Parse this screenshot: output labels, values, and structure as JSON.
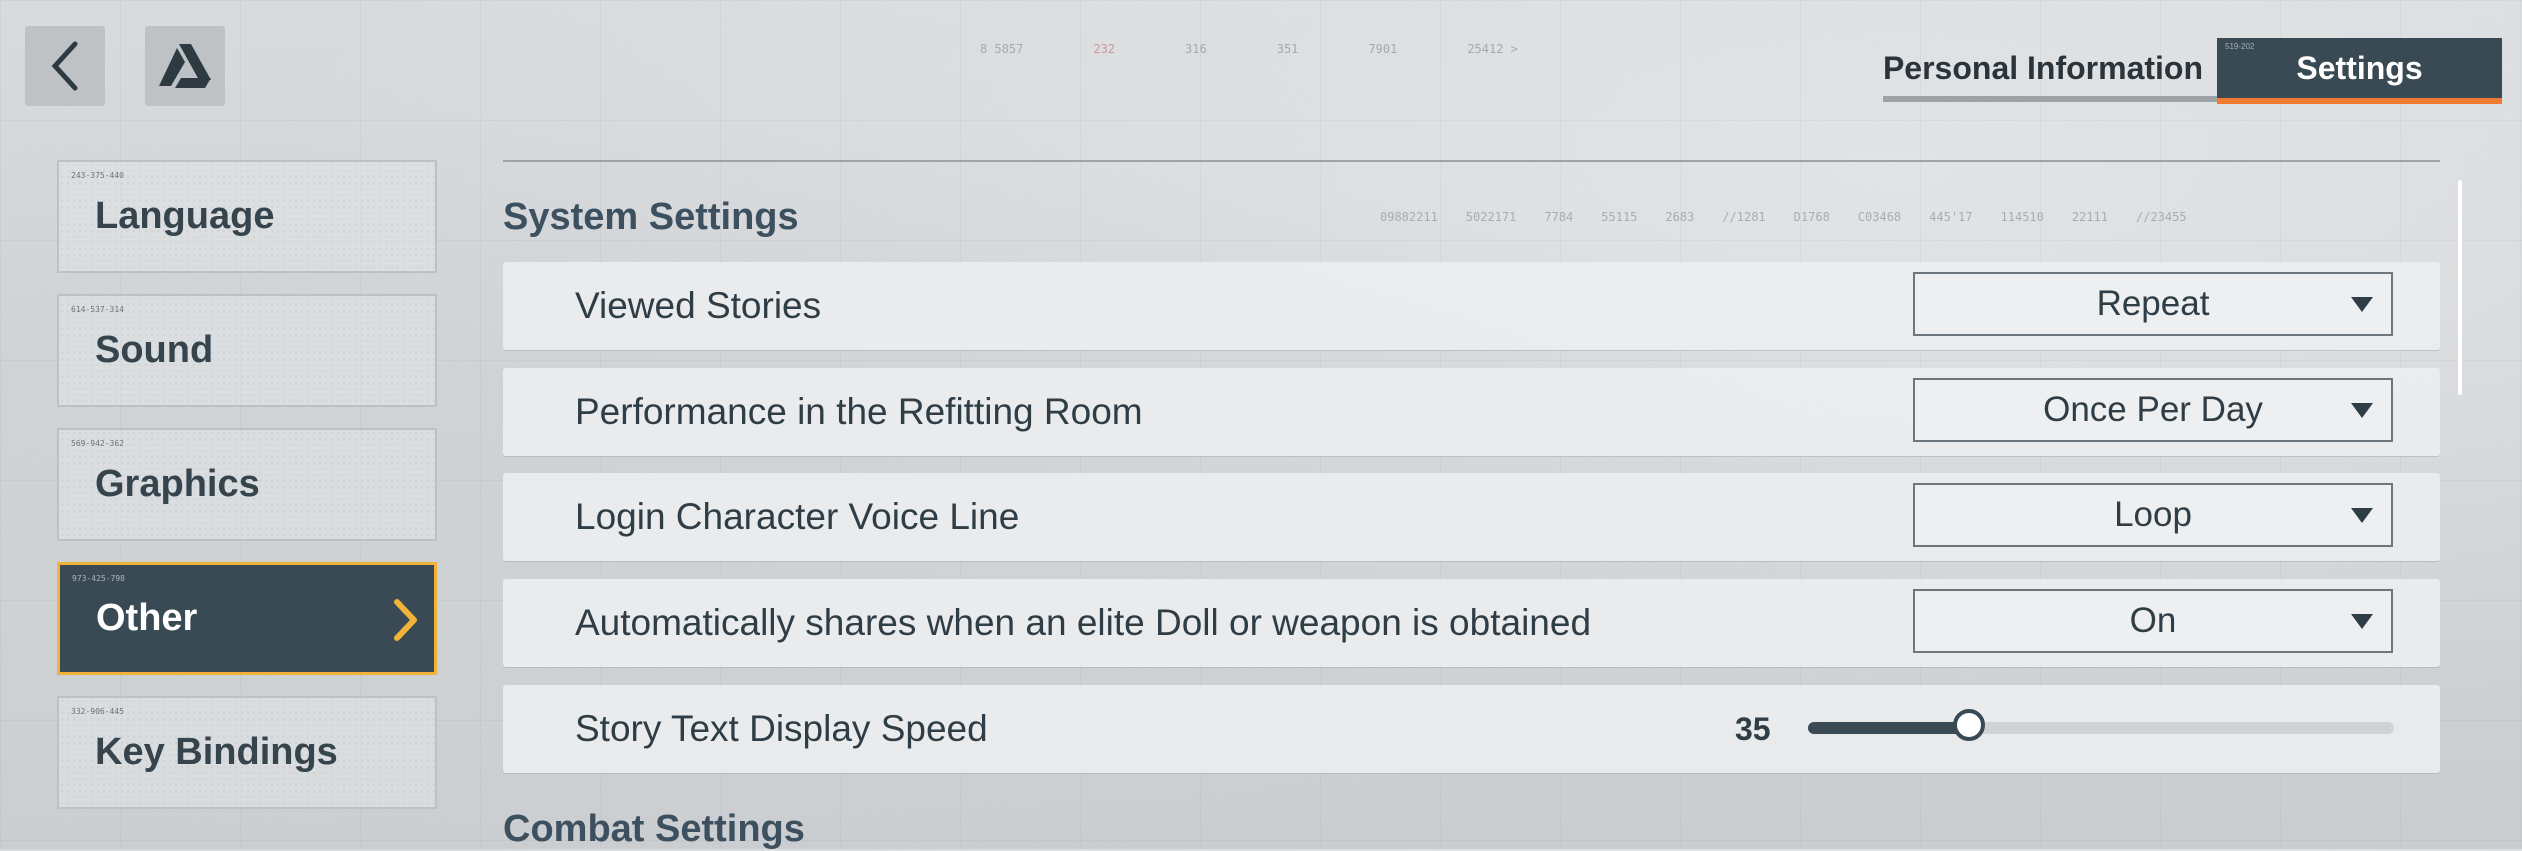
{
  "top_codes": [
    "8  5857",
    "232",
    "316",
    "351",
    "7901",
    "25412  >"
  ],
  "mid_codes": [
    "09882211",
    "5022171",
    "7784",
    "55115",
    "2683",
    "//1281",
    "D1768",
    "C03468",
    "445'17",
    "114510",
    "22111",
    "//23455"
  ],
  "nav": {
    "back_icon": "chevron-left-icon",
    "logo_icon": "triangle-logo-icon"
  },
  "tabs": [
    {
      "label": "Personal Information",
      "active": false
    },
    {
      "label": "Settings",
      "active": true,
      "code": "519-202"
    }
  ],
  "sidebar": {
    "items": [
      {
        "label": "Language",
        "code": "243-375-440"
      },
      {
        "label": "Sound",
        "code": "614-537-314"
      },
      {
        "label": "Graphics",
        "code": "569-942-362"
      },
      {
        "label": "Other",
        "code": "973-425-798",
        "active": true
      },
      {
        "label": "Key Bindings",
        "code": "332-906-445"
      }
    ]
  },
  "sections": {
    "system": "System Settings",
    "combat": "Combat Settings"
  },
  "settings": {
    "viewed_stories": {
      "label": "Viewed Stories",
      "value": "Repeat"
    },
    "refitting_room": {
      "label": "Performance in the Refitting Room",
      "value": "Once Per Day"
    },
    "login_voice": {
      "label": "Login Character Voice Line",
      "value": "Loop"
    },
    "auto_share": {
      "label": "Automatically shares when an elite Doll or weapon is obtained",
      "value": "On"
    },
    "text_speed": {
      "label": "Story Text Display Speed",
      "value": "35",
      "fraction": 0.275
    }
  },
  "colors": {
    "accent_orange": "#f07a2f",
    "active_border": "#f2b23a",
    "dark_slate": "#3a4a54"
  }
}
